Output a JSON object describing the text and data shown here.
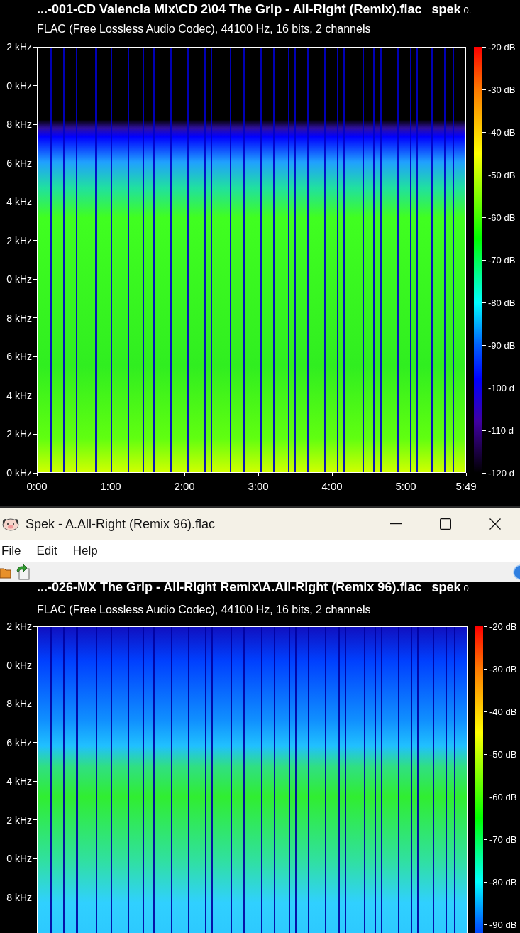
{
  "panels": [
    {
      "title": "...-001-CD Valencia Mix\\CD 2\\04 The Grip - All-Right (Remix).flac",
      "brand": "spek",
      "version": "0.",
      "info": "FLAC (Free Lossless Audio Codec), 44100 Hz, 16 bits, 2 channels",
      "freq_labels": [
        "2 kHz",
        "0 kHz",
        "8 kHz",
        "6 kHz",
        "4 kHz",
        "2 kHz",
        "0 kHz",
        "8 kHz",
        "6 kHz",
        "4 kHz",
        "2 kHz",
        "0 kHz"
      ],
      "db_labels": [
        "-20 dB",
        "-30 dB",
        "-40 dB",
        "-50 dB",
        "-60 dB",
        "-70 dB",
        "-80 dB",
        "-90 dB",
        "-100 d",
        "-110 d",
        "-120 d"
      ],
      "time_labels": [
        "0:00",
        "1:00",
        "2:00",
        "3:00",
        "4:00",
        "5:00",
        "5:49"
      ]
    },
    {
      "window": {
        "title": "Spek - A.All-Right (Remix 96).flac"
      },
      "menu": [
        "File",
        "Edit",
        "Help"
      ],
      "title": "...-026-MX The Grip - All-Right Remix\\A.All-Right (Remix 96).flac",
      "brand": "spek",
      "version": "0",
      "info": "FLAC (Free Lossless Audio Codec), 44100 Hz, 16 bits, 2 channels",
      "freq_labels": [
        "2 kHz",
        "0 kHz",
        "8 kHz",
        "6 kHz",
        "4 kHz",
        "2 kHz",
        "0 kHz",
        "8 kHz"
      ],
      "db_labels": [
        "-20 dB",
        "-30 dB",
        "-40 dB",
        "-50 dB",
        "-60 dB",
        "-70 dB",
        "-80 dB",
        "-90 dB"
      ]
    }
  ]
}
